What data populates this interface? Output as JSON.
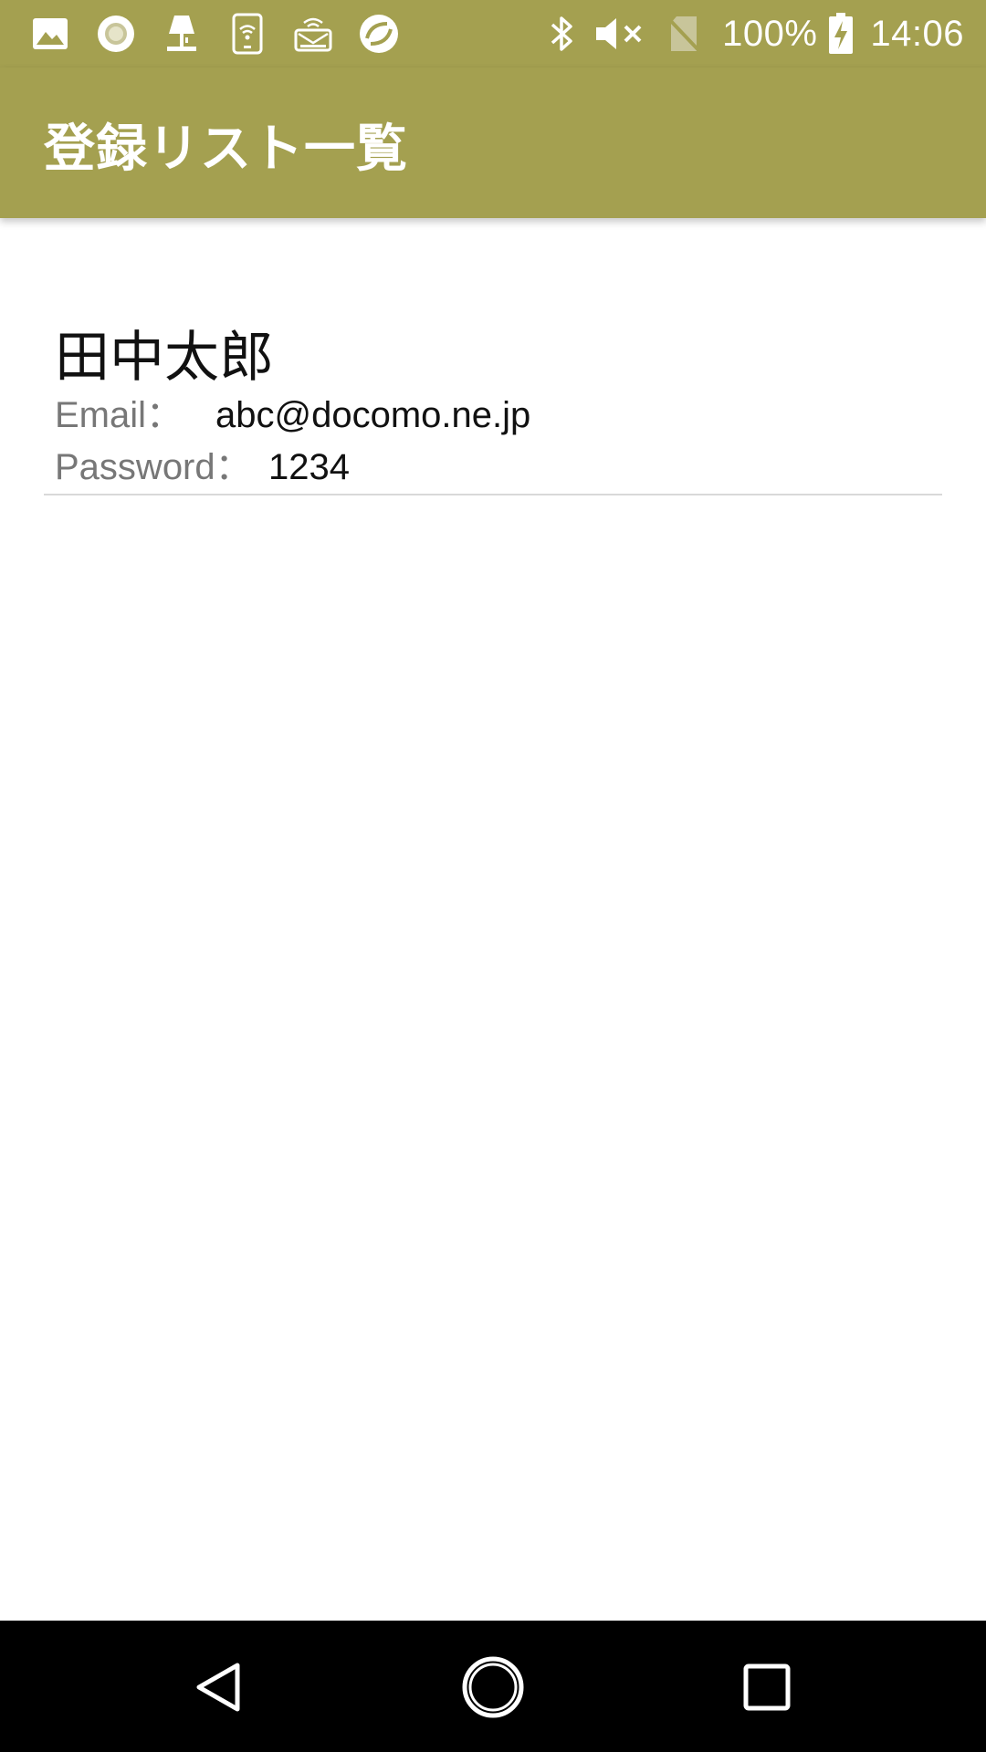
{
  "status_bar": {
    "left_icons": [
      "image-icon",
      "ring-icon",
      "lamp-icon",
      "phone-wifi-icon",
      "router-icon",
      "sync-icon"
    ],
    "right_icons": [
      "bluetooth-icon",
      "mute-icon",
      "no-sim-icon"
    ],
    "battery": "100%",
    "time": "14:06"
  },
  "app_bar": {
    "title": "登録リスト一覧",
    "color": "#a4a050"
  },
  "list": {
    "items": [
      {
        "name": "田中太郎",
        "email_label": "Email：",
        "email_value": "abc@docomo.ne.jp",
        "password_label": "Password：",
        "password_value": "1234"
      }
    ]
  },
  "nav_bar": {
    "buttons": [
      "back-icon",
      "home-icon",
      "recents-icon"
    ]
  }
}
